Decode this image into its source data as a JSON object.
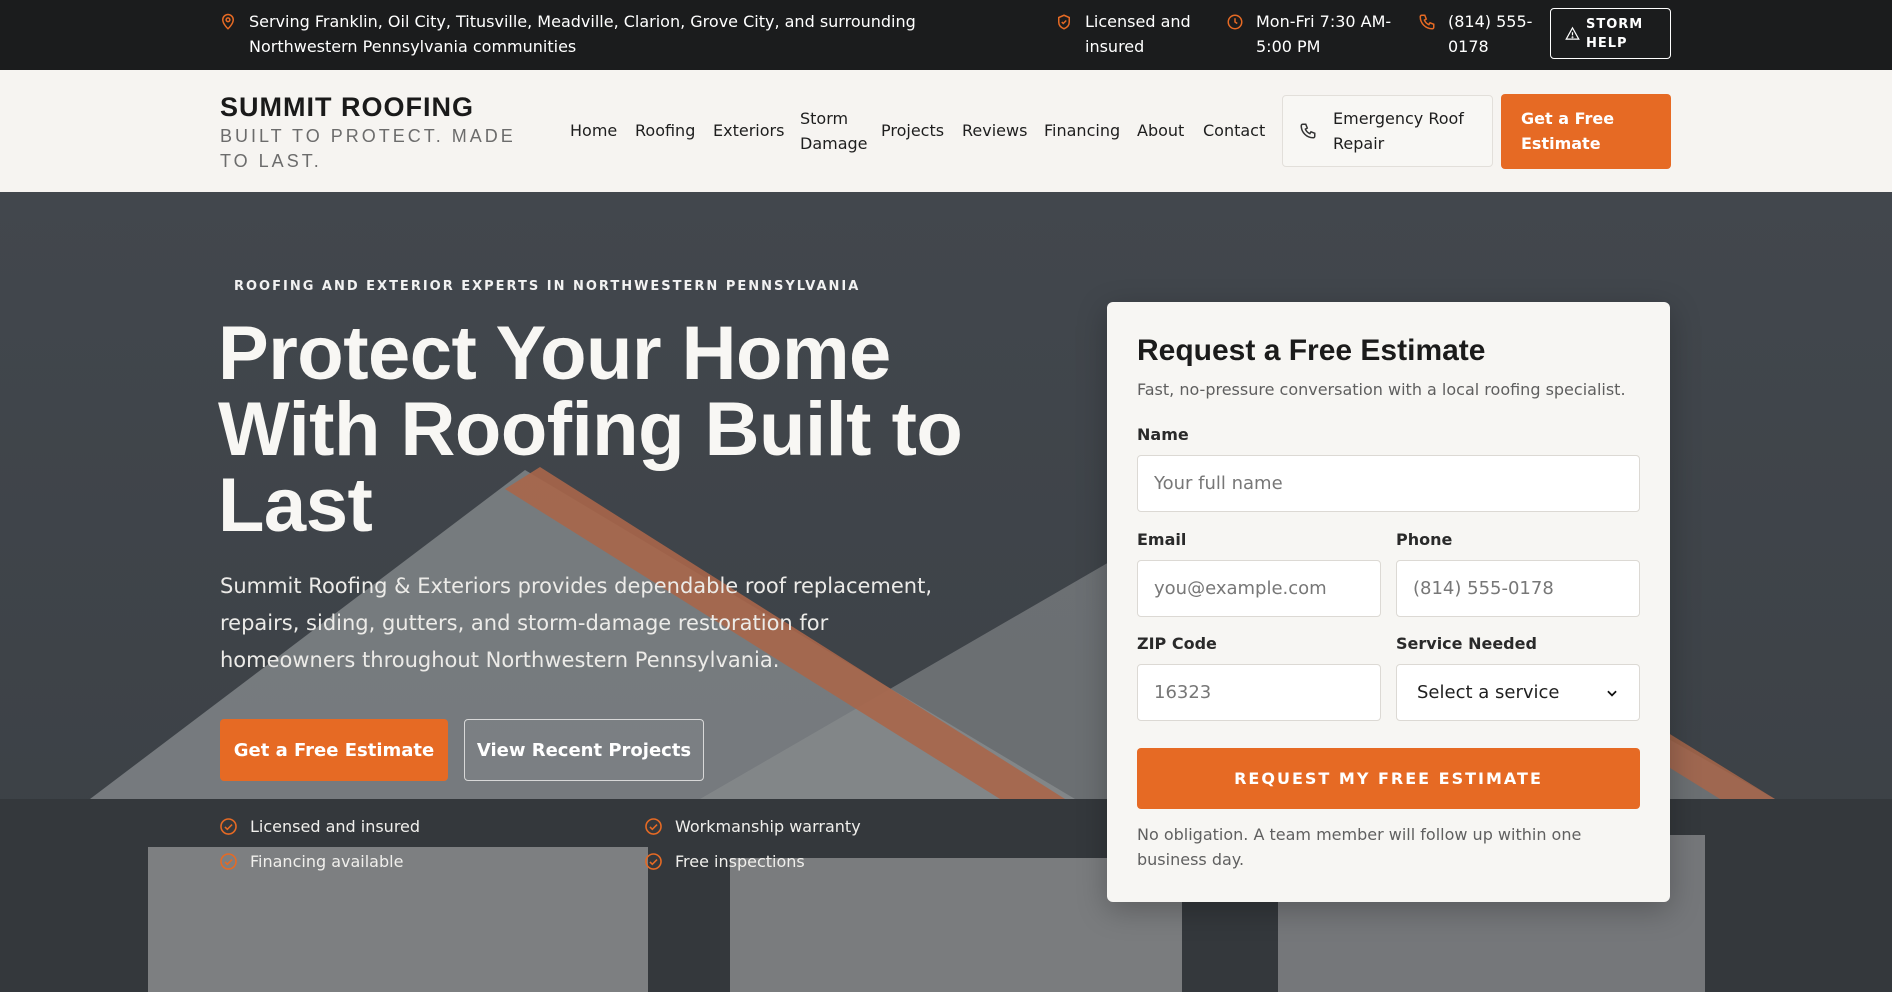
{
  "colors": {
    "accent": "#e66a24",
    "topbar_bg": "#1b1c1d",
    "header_bg": "#f6f4f1",
    "hero_bg": "#3f4449"
  },
  "topbar": {
    "service_area": "Serving Franklin, Oil City, Titusville, Meadville, Clarion, Grove City, and surrounding Northwestern Pennsylvania communities",
    "licensed": "Licensed and insured",
    "hours": "Mon-Fri 7:30 AM-5:00 PM",
    "phone": "(814) 555-0178",
    "storm_help": "STORM HELP",
    "icons": {
      "location": "map-pin-icon",
      "licensed": "shield-check-icon",
      "hours": "clock-icon",
      "phone": "phone-icon",
      "storm": "alert-triangle-icon"
    }
  },
  "header": {
    "brand_name": "SUMMIT ROOFING",
    "brand_tagline": "BUILT TO PROTECT. MADE TO LAST.",
    "nav": [
      "Home",
      "Roofing",
      "Exteriors",
      "Storm Damage",
      "Projects",
      "Reviews",
      "Financing",
      "About",
      "Contact"
    ],
    "emergency_label": "Emergency Roof Repair",
    "estimate_label": "Get a Free Estimate"
  },
  "hero": {
    "eyebrow": "ROOFING AND EXTERIOR EXPERTS IN NORTHWESTERN PENNSYLVANIA",
    "headline": "Protect Your Home With Roofing Built to Last",
    "description": "Summit Roofing & Exteriors provides dependable roof replacement, repairs, siding, gutters, and storm-damage restoration for homeowners throughout Northwestern Pennsylvania.",
    "primary_cta": "Get a Free Estimate",
    "secondary_cta": "View Recent Projects",
    "features": [
      "Licensed and insured",
      "Workmanship warranty",
      "Financing available",
      "Free inspections"
    ]
  },
  "form": {
    "title": "Request a Free Estimate",
    "subtitle": "Fast, no-pressure conversation with a local roofing specialist.",
    "name_label": "Name",
    "name_placeholder": "Your full name",
    "email_label": "Email",
    "email_placeholder": "you@example.com",
    "phone_label": "Phone",
    "phone_placeholder": "(814) 555-0178",
    "zip_label": "ZIP Code",
    "zip_placeholder": "16323",
    "service_label": "Service Needed",
    "service_selected": "Select a service",
    "submit_label": "REQUEST MY FREE ESTIMATE",
    "note": "No obligation. A team member will follow up within one business day."
  }
}
